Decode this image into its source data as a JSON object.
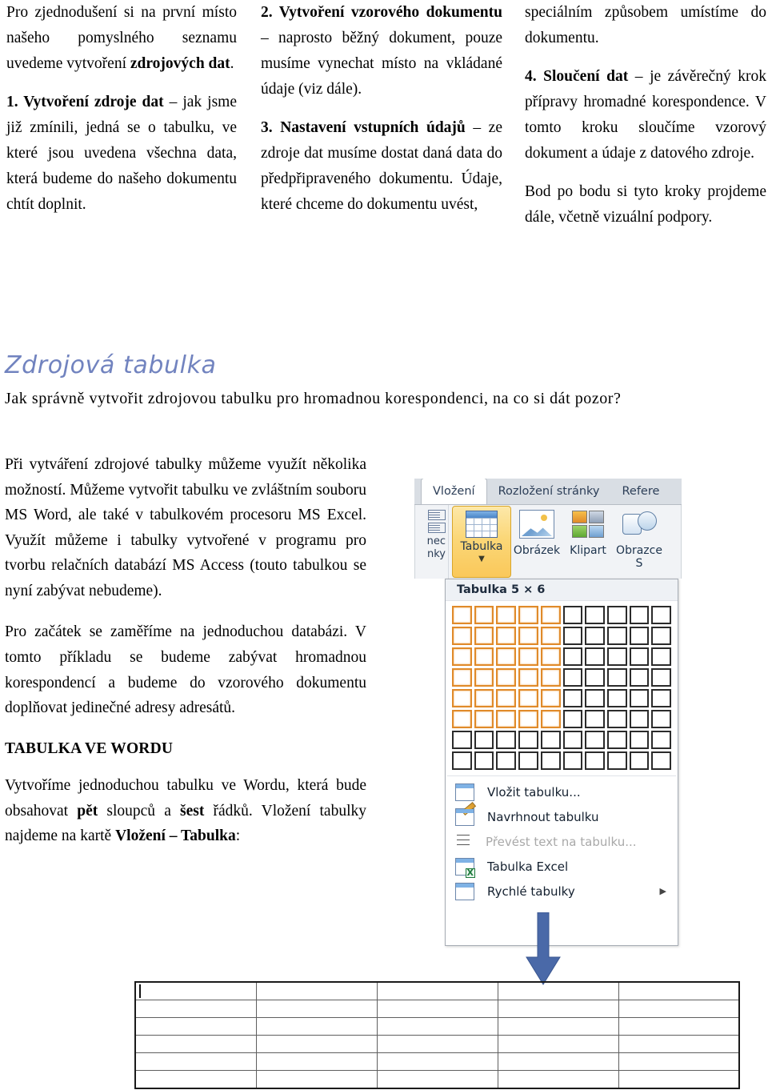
{
  "top_columns": [
    {
      "paragraphs": [
        [
          {
            "t": "Pro zjednodušení si na první místo našeho pomyslného seznamu uvedeme vytvoření ",
            "b": false
          },
          {
            "t": "zdrojových dat",
            "b": true
          },
          {
            "t": ".",
            "b": false
          }
        ],
        [
          {
            "t": "1. Vytvoření zdroje dat",
            "b": true
          },
          {
            "t": " – jak jsme již zmínili, jedná se o tabulku, ve které jsou uvedena všechna data, která budeme do našeho dokumentu chtít doplnit.",
            "b": false
          }
        ]
      ]
    },
    {
      "paragraphs": [
        [
          {
            "t": "2. Vytvoření vzorového dokumentu",
            "b": true
          },
          {
            "t": " – naprosto běžný dokument, pouze musíme vynechat místo na vkládané údaje (viz dále).",
            "b": false
          }
        ],
        [
          {
            "t": "3. Nastavení vstupních údajů",
            "b": true
          },
          {
            "t": " – ze zdroje dat musíme dostat daná data do předpřipraveného dokumentu. Údaje, které chceme do dokumentu uvést,",
            "b": false
          }
        ]
      ]
    },
    {
      "paragraphs": [
        [
          {
            "t": "speciálním způsobem umístíme do dokumentu.",
            "b": false
          }
        ],
        [
          {
            "t": "4. Sloučení dat",
            "b": true
          },
          {
            "t": " – je závěrečný krok přípravy hromadné korespondence. V tomto kroku sloučíme vzorový dokument a údaje z datového zdroje.",
            "b": false
          }
        ],
        [
          {
            "t": "Bod po bodu si tyto kroky projdeme dále, včetně vizuální podpory.",
            "b": false
          }
        ]
      ]
    }
  ],
  "section": {
    "heading": "Zdrojová tabulka",
    "heading_color": "#7183bf",
    "subtitle": "Jak správně vytvořit zdrojovou tabulku pro hromadnou korespondenci, na co si dát pozor?"
  },
  "body_left": {
    "para1": [
      {
        "t": "Při vytváření zdrojové tabulky můžeme využít několika možností. Můžeme vytvořit tabulku ve zvláštním souboru MS Word, ale také v tabulkovém procesoru MS Excel. Využít můžeme i tabulky vytvořené v programu pro tvorbu relačních databází MS Access (touto tabulkou se nyní zabývat nebudeme).",
        "b": false
      }
    ],
    "para2": [
      {
        "t": "Pro začátek se zaměříme na jednoduchou databázi. V tomto příkladu se budeme zabývat hromadnou korespondencí a budeme do vzorového dokumentu doplňovat jedinečné adresy adresátů.",
        "b": false
      }
    ],
    "subheading": "TABULKA VE WORDU",
    "para3": [
      {
        "t": "Vytvoříme jednoduchou tabulku ve Wordu, která bude obsahovat ",
        "b": false
      },
      {
        "t": "pět",
        "b": true
      },
      {
        "t": " sloupců a ",
        "b": false
      },
      {
        "t": "šest",
        "b": true
      },
      {
        "t": " řádků. Vložení tabulky najdeme na kartě ",
        "b": false
      },
      {
        "t": "Vložení – Tabulka",
        "b": true
      },
      {
        "t": ":",
        "b": false
      }
    ]
  },
  "ribbon": {
    "tabs": [
      {
        "label": "Vložení",
        "active": true
      },
      {
        "label": "Rozložení stránky",
        "active": false
      },
      {
        "label": "Refere",
        "active": false
      }
    ],
    "left_stub_line1": "nec",
    "left_stub_line2": "nky",
    "buttons": [
      {
        "label": "Tabulka",
        "icon": "table-icon",
        "active": true,
        "has_caret": true
      },
      {
        "label": "Obrázek",
        "icon": "picture-icon",
        "active": false,
        "has_caret": false
      },
      {
        "label": "Klipart",
        "icon": "clipart-icon",
        "active": false,
        "has_caret": false
      },
      {
        "label": "Obrazce S",
        "icon": "shapes-icon",
        "active": false,
        "has_caret": true
      }
    ]
  },
  "dropdown": {
    "title": "Tabulka 5 × 6",
    "grid": {
      "cols": 10,
      "rows": 8,
      "selected_cols": 5,
      "selected_rows": 6,
      "selected_color": "#e08a2a",
      "normal_color": "#2b2b2b"
    },
    "menu_items": [
      {
        "label": "Vložit tabulku...",
        "icon": "insert-table-icon",
        "disabled": false,
        "submenu": false
      },
      {
        "label": "Navrhnout tabulku",
        "icon": "draw-table-icon",
        "disabled": false,
        "submenu": false
      },
      {
        "label": "Převést text na tabulku...",
        "icon": "convert-text-icon",
        "disabled": true,
        "submenu": false
      },
      {
        "label": "Tabulka Excel",
        "icon": "excel-table-icon",
        "disabled": false,
        "submenu": false
      },
      {
        "label": "Rychlé tabulky",
        "icon": "quick-tables-icon",
        "disabled": false,
        "submenu": true
      }
    ]
  },
  "arrow": {
    "name": "down-arrow",
    "color": "#4a69a8"
  },
  "doc_table": {
    "columns": 5,
    "rows": 6,
    "cursor_cell": {
      "row": 0,
      "col": 0
    }
  }
}
